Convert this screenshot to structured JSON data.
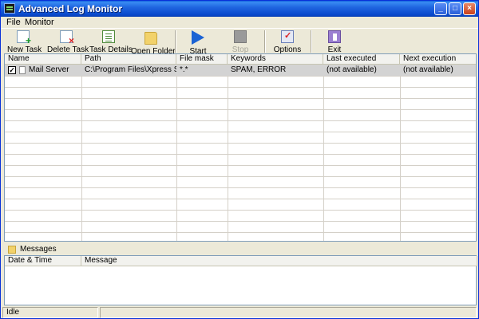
{
  "window": {
    "title": "Advanced Log Monitor"
  },
  "menu": {
    "file": "File",
    "monitor": "Monitor"
  },
  "toolbar": {
    "new_task": "New Task",
    "delete_task": "Delete Task",
    "task_details": "Task Details",
    "open_folder": "Open Folder",
    "start": "Start",
    "stop": "Stop",
    "options": "Options",
    "exit": "Exit"
  },
  "tasks": {
    "columns": [
      "Name",
      "Path",
      "File mask",
      "Keywords",
      "Last executed",
      "Next execution"
    ],
    "rows": [
      {
        "checked": true,
        "name": "Mail Server",
        "path": "C:\\Program Files\\Xpress S...",
        "file_mask": "*.*",
        "keywords": "SPAM, ERROR",
        "last_executed": "(not available)",
        "next_execution": "(not available)"
      }
    ]
  },
  "messages": {
    "title": "Messages",
    "columns": [
      "Date & Time",
      "Message"
    ]
  },
  "status": {
    "text": "Idle"
  },
  "colors": {
    "titlebar": "#0848cc",
    "selected_row": "#d3d3d3",
    "face": "#ece9d8"
  }
}
